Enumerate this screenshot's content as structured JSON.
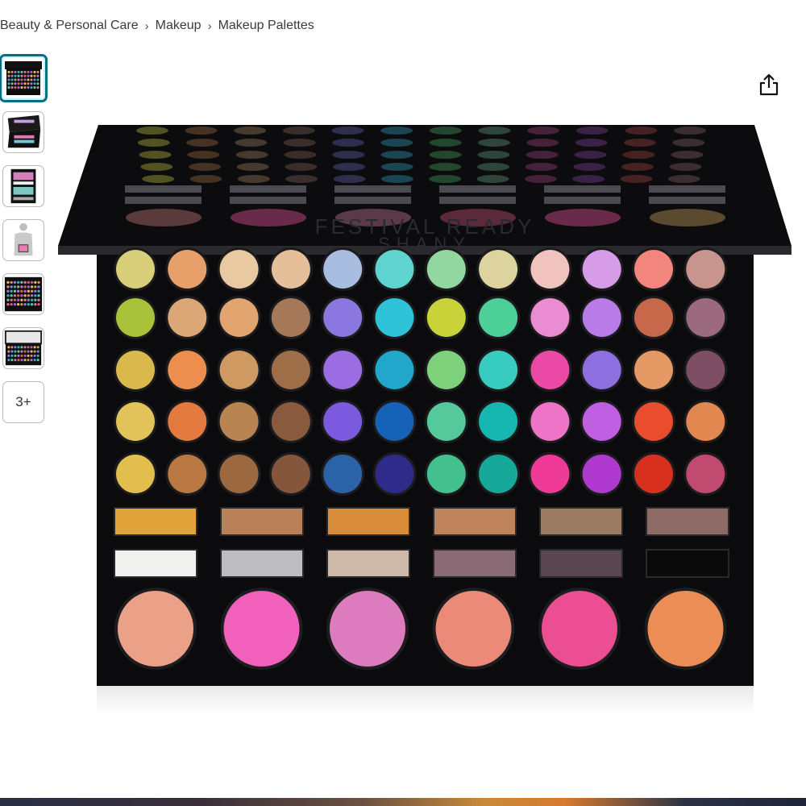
{
  "breadcrumb": {
    "items": [
      "Beauty & Personal Care",
      "Makeup",
      "Makeup Palettes"
    ],
    "separator": "›"
  },
  "thumbnails": {
    "selected_index": 0,
    "more_label": "3+"
  },
  "share": {
    "icon": "share-icon"
  },
  "product_image": {
    "lid_text": "FESTIVAL READY",
    "brand_text": "SHANY",
    "colors": {
      "selection": "#007185",
      "palette_case": "#0b0b0d"
    }
  }
}
